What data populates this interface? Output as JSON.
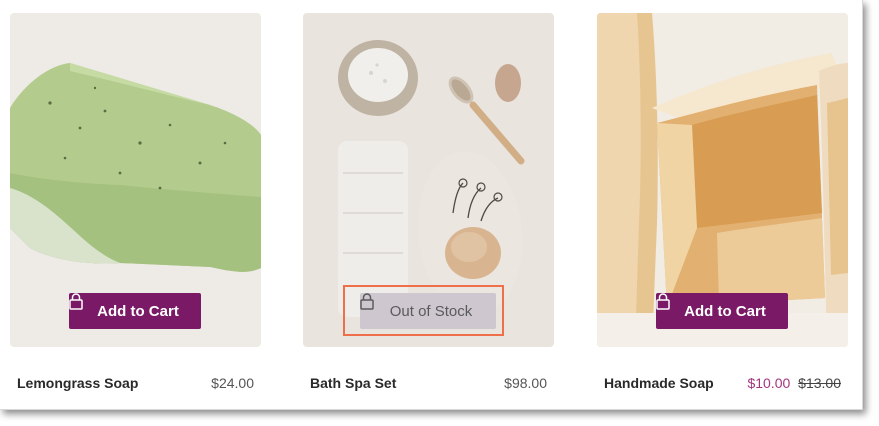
{
  "products": [
    {
      "name": "Lemongrass Soap",
      "price": "$24.00",
      "button_label": "Add to Cart",
      "image": "lemongrass-soap-photo"
    },
    {
      "name": "Bath Spa Set",
      "price": "$98.00",
      "button_label": "Out of Stock",
      "image": "bath-spa-set-photo"
    },
    {
      "name": "Handmade Soap",
      "sale_price": "$10.00",
      "original_price": "$13.00",
      "button_label": "Add to Cart",
      "image": "handmade-soap-photo"
    }
  ],
  "colors": {
    "button_primary": "#7a1a66",
    "button_disabled": "#cec7cf",
    "sale_price": "#a4357f",
    "highlight_box": "#ef6f4b"
  },
  "icons": {
    "button_icon": "lock-icon"
  }
}
